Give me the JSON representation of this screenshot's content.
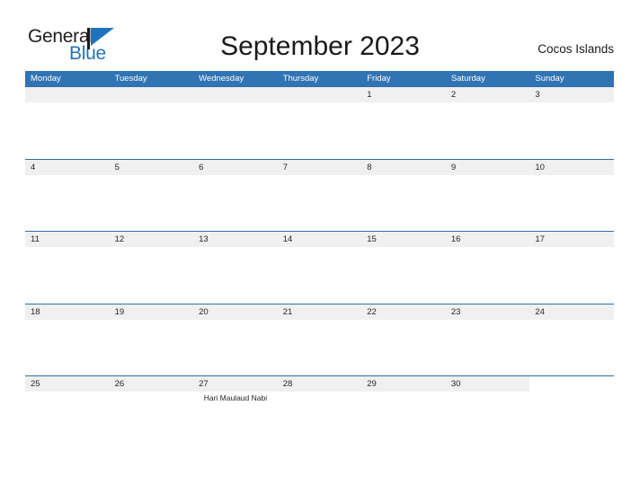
{
  "brand": {
    "name_part1": "General",
    "name_part2": "Blue",
    "flag_icon": "blue-triangle-flag-icon",
    "color_dark": "#231f20",
    "color_blue": "#1f74bd"
  },
  "header": {
    "title": "September 2023",
    "location": "Cocos Islands"
  },
  "calendar": {
    "accent_color": "#3074b4",
    "band_color": "#f0f0f0",
    "rule_color": "#2e6fa8",
    "weekdays": [
      "Monday",
      "Tuesday",
      "Wednesday",
      "Thursday",
      "Friday",
      "Saturday",
      "Sunday"
    ],
    "weeks": [
      {
        "days": [
          "",
          "",
          "",
          "",
          "1",
          "2",
          "3"
        ],
        "events": [
          "",
          "",
          "",
          "",
          "",
          "",
          ""
        ]
      },
      {
        "days": [
          "4",
          "5",
          "6",
          "7",
          "8",
          "9",
          "10"
        ],
        "events": [
          "",
          "",
          "",
          "",
          "",
          "",
          ""
        ]
      },
      {
        "days": [
          "11",
          "12",
          "13",
          "14",
          "15",
          "16",
          "17"
        ],
        "events": [
          "",
          "",
          "",
          "",
          "",
          "",
          ""
        ]
      },
      {
        "days": [
          "18",
          "19",
          "20",
          "21",
          "22",
          "23",
          "24"
        ],
        "events": [
          "",
          "",
          "",
          "",
          "",
          "",
          ""
        ]
      },
      {
        "days": [
          "25",
          "26",
          "27",
          "28",
          "29",
          "30",
          ""
        ],
        "events": [
          "",
          "",
          "Hari Maulaud Nabi",
          "",
          "",
          "",
          ""
        ]
      }
    ]
  }
}
